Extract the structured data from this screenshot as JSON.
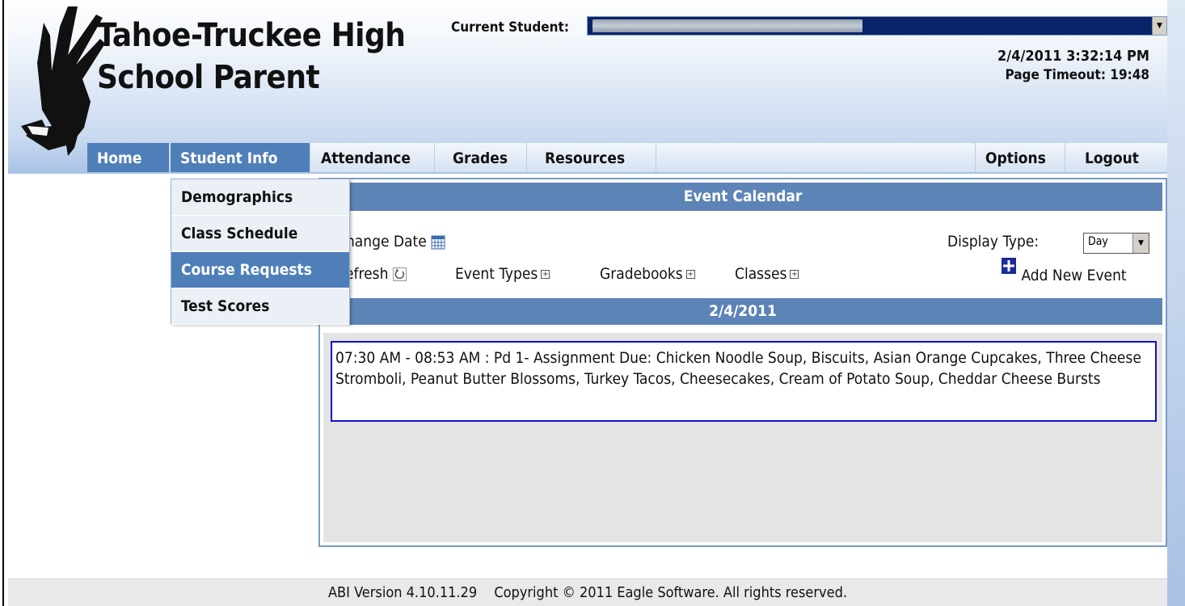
{
  "header": {
    "school_name": "Tahoe-Truckee High School Parent",
    "current_student_label": "Current Student:",
    "datetime": "2/4/2011 3:32:14 PM",
    "page_timeout": "Page Timeout:  19:48"
  },
  "nav": {
    "items": [
      {
        "label": "Home"
      },
      {
        "label": "Student Info"
      },
      {
        "label": "Attendance"
      },
      {
        "label": "Grades"
      },
      {
        "label": "Resources"
      },
      {
        "label": "Options"
      },
      {
        "label": "Logout"
      }
    ]
  },
  "student_info_menu": {
    "items": [
      {
        "label": "Demographics"
      },
      {
        "label": "Class Schedule"
      },
      {
        "label": "Course Requests"
      },
      {
        "label": "Test Scores"
      }
    ]
  },
  "calendar": {
    "title": "Event Calendar",
    "change_date": "Change Date",
    "refresh": "Refresh",
    "event_types": "Event Types",
    "gradebooks": "Gradebooks",
    "classes": "Classes",
    "display_type_label": "Display Type:",
    "display_type_value": "Day",
    "add_new_event": "Add New Event",
    "date": "2/4/2011",
    "events": [
      {
        "text": "07:30 AM - 08:53 AM : Pd 1- Assignment Due: Chicken Noodle Soup, Biscuits, Asian Orange Cupcakes, Three Cheese Stromboli, Peanut Butter Blossoms, Turkey Tacos, Cheesecakes, Cream of Potato Soup, Cheddar Cheese Bursts"
      }
    ]
  },
  "footer": {
    "version": "ABI Version 4.10.11.29",
    "copyright": "Copyright © 2011 Eagle Software. All rights reserved."
  },
  "icons": {
    "logo": "eagle-logo",
    "calendar": "calendar-icon",
    "refresh": "refresh-icon",
    "expand": "expand-icon",
    "add": "add-icon"
  },
  "colors": {
    "nav_active": "#4f7fb9",
    "panel_header": "#5d84b7",
    "event_border": "#1010c8",
    "student_select": "#0a246a"
  }
}
